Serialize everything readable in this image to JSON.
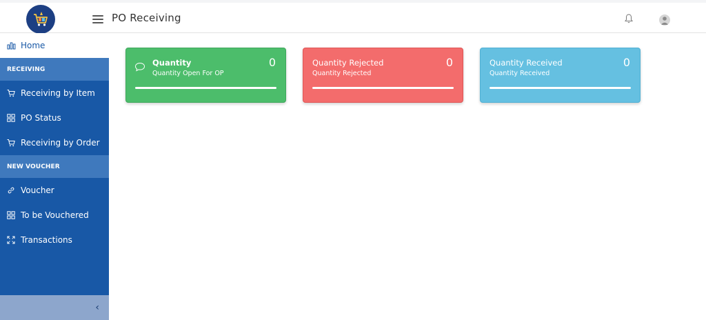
{
  "header": {
    "title": "PO Receiving",
    "icons": [
      "menu-icon",
      "bell-icon",
      "user-avatar-icon"
    ]
  },
  "sidebar": {
    "home_label": "Home",
    "sections": [
      {
        "label": "RECEIVING",
        "items": [
          {
            "label": "Receiving by Item",
            "icon": "cart-icon"
          },
          {
            "label": "PO Status",
            "icon": "grid-icon"
          },
          {
            "label": "Receiving by Order",
            "icon": "cart-icon"
          }
        ]
      },
      {
        "label": "NEW VOUCHER",
        "items": [
          {
            "label": "Voucher",
            "icon": "link-icon"
          },
          {
            "label": "To be Vouchered",
            "icon": "grid-icon"
          },
          {
            "label": "Transactions",
            "icon": "expand-icon"
          }
        ]
      }
    ],
    "collapse_glyph": "‹"
  },
  "cards": [
    {
      "title": "Quantity",
      "subtitle": "Quantity Open For OP",
      "value": "0",
      "color": "#4cbd6b"
    },
    {
      "title": "Quantity Rejected",
      "subtitle": "Quantity Rejected",
      "value": "0",
      "color": "#f36c6c"
    },
    {
      "title": "Quantity Received",
      "subtitle": "Quantity Received",
      "value": "0",
      "color": "#65c0e1"
    }
  ]
}
